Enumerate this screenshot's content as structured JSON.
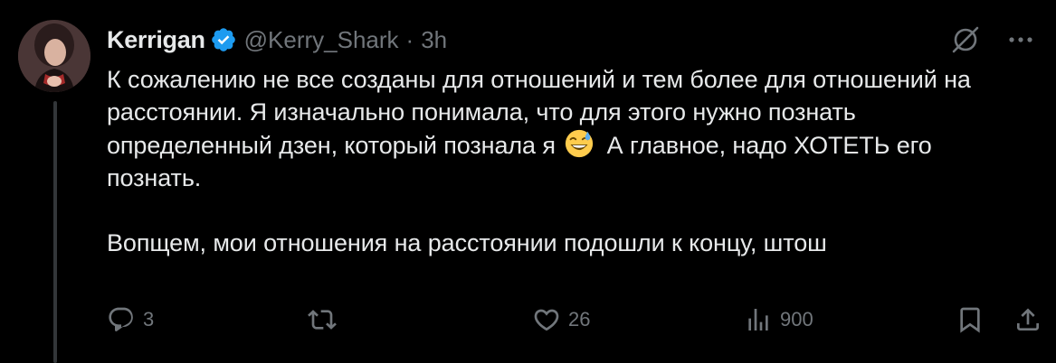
{
  "author": {
    "display_name": "Kerrigan",
    "handle": "@Kerry_Shark",
    "separator": "·",
    "time": "3h",
    "verified": true
  },
  "tweet": {
    "paragraph_1_a": "К сожалению не все созданы для отношений и тем более для отношений на расстоянии. Я изначально понимала, что для этого нужно познать определенный дзен, который познала я",
    "emoji": "grinning-face-with-sweat",
    "paragraph_1_b": "А главное, надо ХОТЕТЬ его познать.",
    "paragraph_2": "Вопщем, мои отношения на расстоянии подошли к концу, штош"
  },
  "actions": {
    "reply_count": "3",
    "retweet_count": "",
    "like_count": "26",
    "views_count": "900"
  },
  "colors": {
    "background": "#000000",
    "text": "#e7e9ea",
    "secondary": "#71767b",
    "verified": "#1d9bf0",
    "thread_line": "#333639"
  },
  "icons": [
    "verified-badge-icon",
    "grok-icon",
    "more-icon",
    "reply-icon",
    "retweet-icon",
    "like-icon",
    "views-icon",
    "bookmark-icon",
    "share-icon"
  ]
}
